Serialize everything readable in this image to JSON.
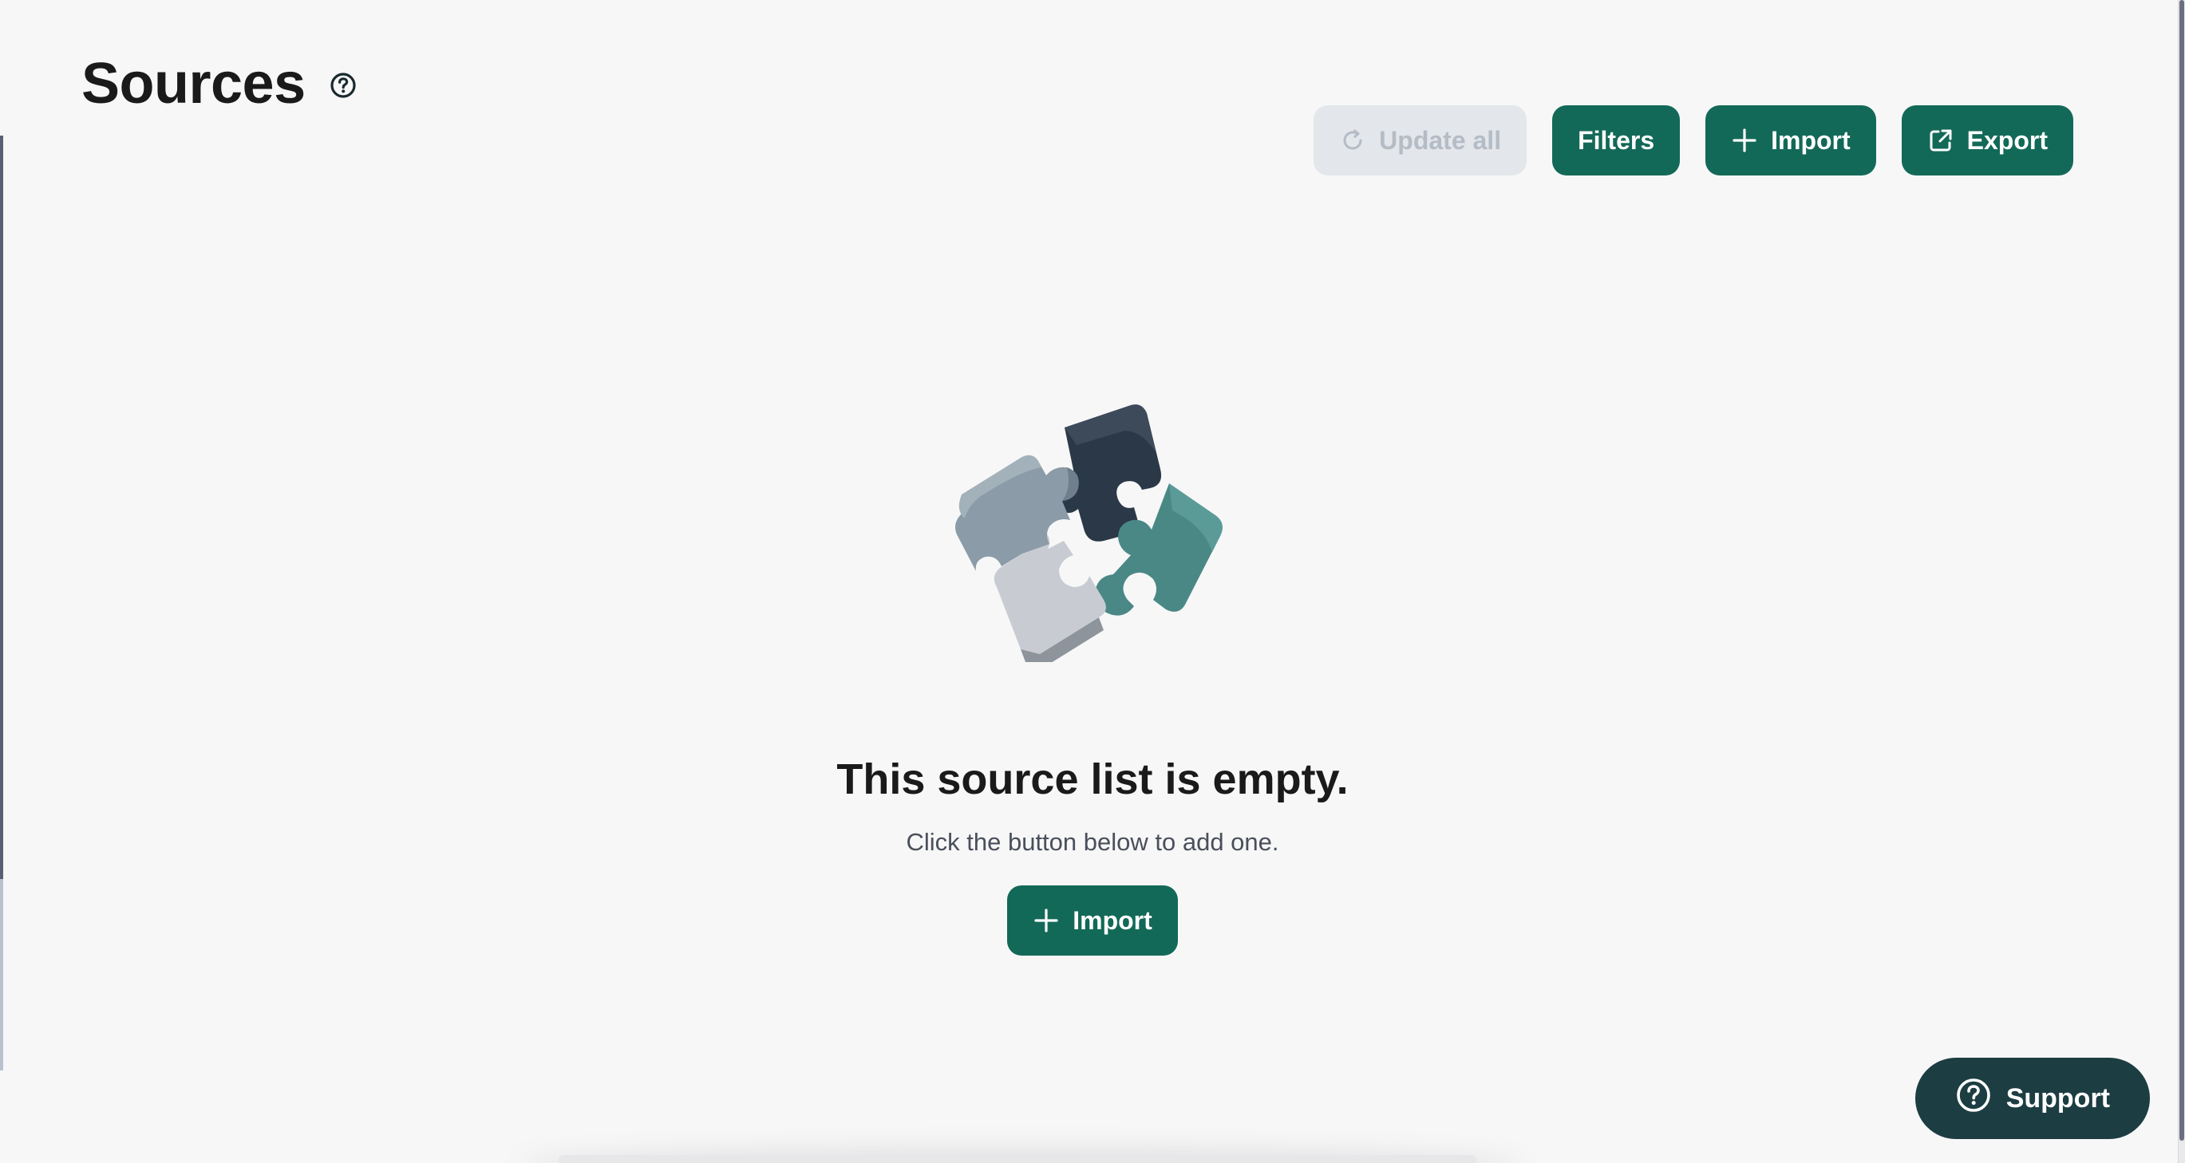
{
  "header": {
    "title": "Sources",
    "help_icon": "question-circle-icon"
  },
  "toolbar": {
    "update_all_label": "Update all",
    "update_all_icon": "refresh-icon",
    "filters_label": "Filters",
    "import_label": "Import",
    "import_icon": "plus-icon",
    "export_label": "Export",
    "export_icon": "external-link-icon"
  },
  "empty_state": {
    "illustration": "puzzle-pieces-icon",
    "title": "This source list is empty.",
    "subtitle": "Click the button below to add one.",
    "import_label": "Import"
  },
  "support": {
    "label": "Support",
    "icon": "question-circle-icon"
  },
  "colors": {
    "primary": "#136958",
    "disabled_bg": "#e3e6ea",
    "disabled_text": "#b4bcc6",
    "support_bg": "#1c3d42",
    "page_bg": "#f7f7f7"
  }
}
